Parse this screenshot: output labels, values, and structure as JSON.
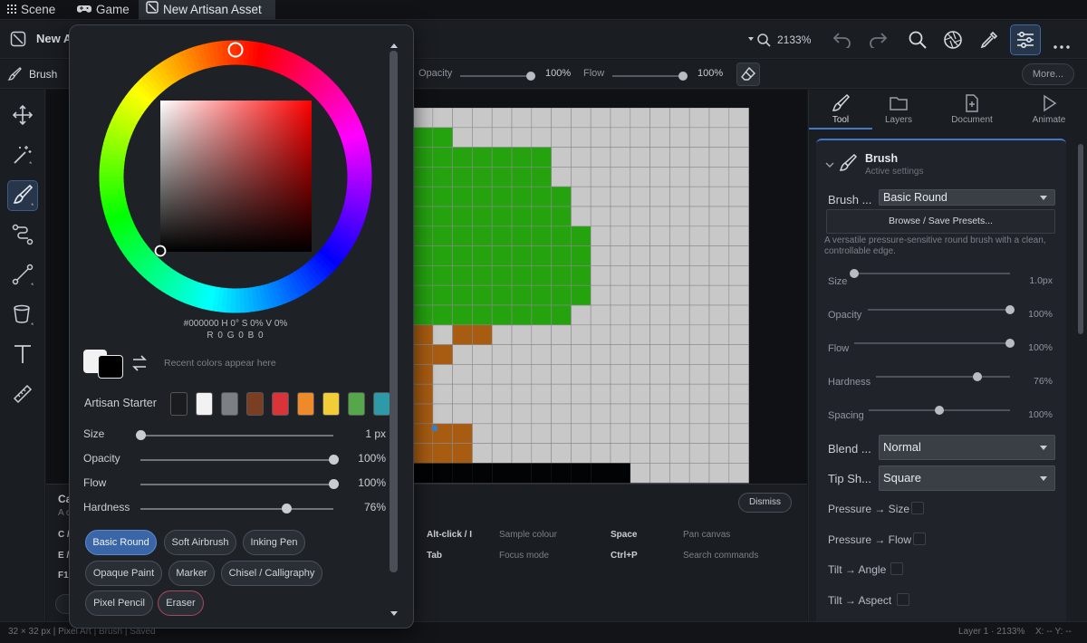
{
  "tabs": [
    {
      "label": "Scene",
      "icon": "grid-icon"
    },
    {
      "label": "Game",
      "icon": "gamepad-icon"
    },
    {
      "label": "New Artisan Asset",
      "icon": "slash-square-icon"
    }
  ],
  "topbar": {
    "doc_title": "New A",
    "zoom": "2133%"
  },
  "tool_options": {
    "tool_label": "Brush",
    "opacity_label": "Opacity",
    "opacity_value": "100%",
    "opacity_level": 1.0,
    "flow_label": "Flow",
    "flow_value": "100%",
    "flow_level": 1.0,
    "more_label": "More..."
  },
  "right_tabs": [
    {
      "label": "Tool",
      "icon": "brush-icon"
    },
    {
      "label": "Layers",
      "icon": "folder-icon"
    },
    {
      "label": "Document",
      "icon": "document-icon"
    },
    {
      "label": "Animate",
      "icon": "play-icon"
    }
  ],
  "brush_panel": {
    "title": "Brush",
    "subtitle": "Active settings",
    "preset_label": "Brush ...",
    "preset_value": "Basic Round",
    "browse_label": "Browse / Save Presets...",
    "description": "A versatile pressure-sensitive round brush with a clean, controllable edge.",
    "sliders": [
      {
        "label": "Size",
        "value": "1.0px",
        "level": 0.0
      },
      {
        "label": "Opacity",
        "value": "100%",
        "level": 1.0
      },
      {
        "label": "Flow",
        "value": "100%",
        "level": 1.0
      },
      {
        "label": "Hardness",
        "value": "76%",
        "level": 0.76
      },
      {
        "label": "Spacing",
        "value": "100%",
        "level": 0.5
      }
    ],
    "blend_label": "Blend ...",
    "blend_value": "Normal",
    "tip_label": "Tip Sh...",
    "tip_value": "Square",
    "toggles": [
      {
        "label": "Pressure → Size"
      },
      {
        "label": "Pressure → Flow"
      },
      {
        "label": "Tilt → Angle"
      },
      {
        "label": "Tilt → Aspect"
      }
    ]
  },
  "color_popup": {
    "readout": "#000000 H 0° S 0% V 0%",
    "rgb": "R 0 G 0 B 0",
    "recent_hint": "Recent colors appear here",
    "palette_label": "Artisan Starter",
    "palette": [
      "#1b1c1f",
      "#f2f2f2",
      "#7b7f86",
      "#7a3e22",
      "#d8343a",
      "#ef8a2b",
      "#f2cd3a",
      "#54a84a",
      "#2e9aa8"
    ],
    "sliders": [
      {
        "label": "Size",
        "value": "1 px",
        "level": 0.0
      },
      {
        "label": "Opacity",
        "value": "100%",
        "level": 1.0
      },
      {
        "label": "Flow",
        "value": "100%",
        "level": 1.0
      },
      {
        "label": "Hardness",
        "value": "76%",
        "level": 0.76
      }
    ],
    "presets": [
      {
        "label": "Basic Round",
        "selected": true
      },
      {
        "label": "Soft Airbrush"
      },
      {
        "label": "Inking Pen"
      },
      {
        "label": "Opaque Paint"
      },
      {
        "label": "Marker"
      },
      {
        "label": "Chisel / Calligraphy"
      },
      {
        "label": "Pixel Pencil"
      },
      {
        "label": "Eraser"
      }
    ]
  },
  "help_panel": {
    "title": "Ca",
    "subtitle": "A c",
    "dismiss_label": "Dismiss",
    "left_keys": [
      "C /",
      "E /",
      "F1"
    ],
    "shortcuts": [
      {
        "key": "Alt-click / I",
        "action": "Sample colour"
      },
      {
        "key": "Space",
        "action": "Pan canvas"
      },
      {
        "key": "Tab",
        "action": "Focus mode"
      },
      {
        "key": "Ctrl+P",
        "action": "Search commands"
      }
    ]
  },
  "status": {
    "left": "32 × 32 px | Pixel Art | Brush | Saved",
    "right_layer": "Layer 1 · 2133%",
    "right_coords": "X: -- Y: --"
  }
}
